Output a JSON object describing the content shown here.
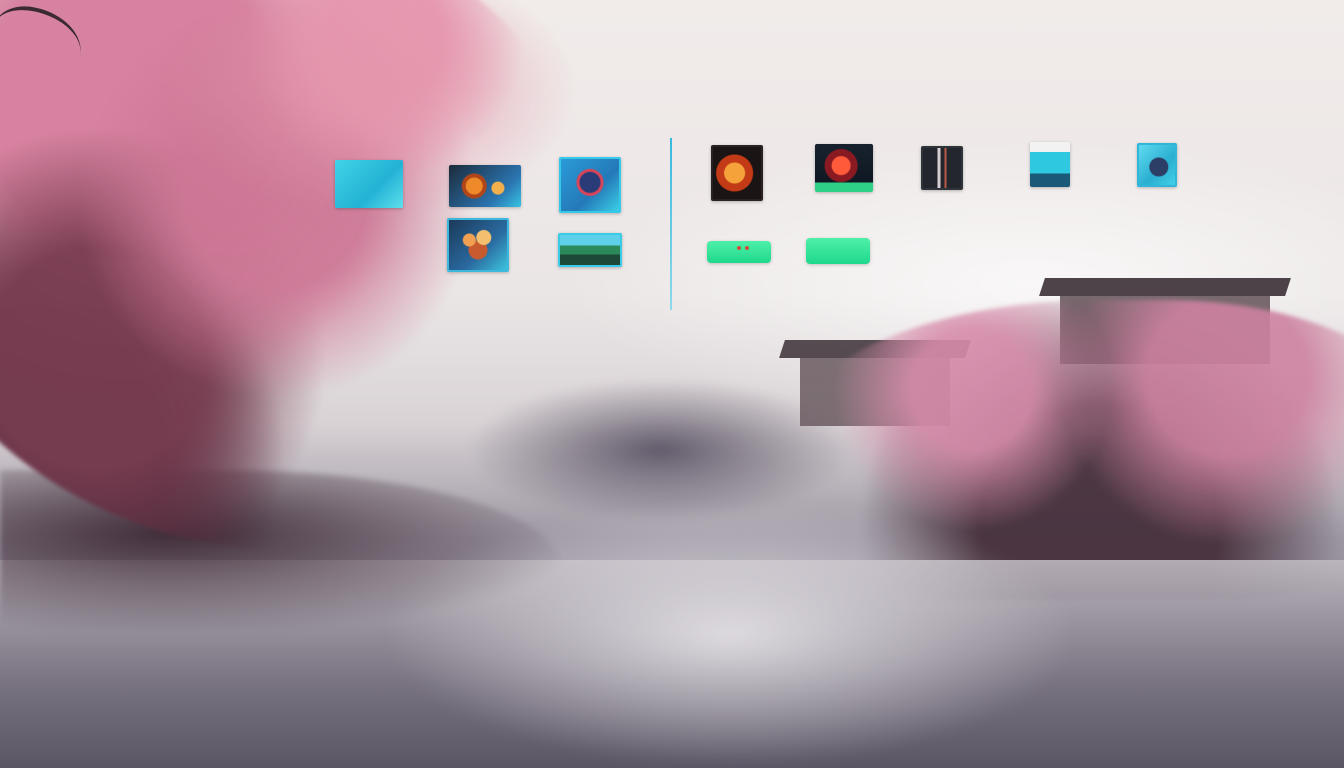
{
  "desktop": {
    "icons": [
      {
        "id": "icon-cyan-window",
        "icon": "app-window-icon",
        "color": "#3fd4e8"
      },
      {
        "id": "icon-food-photo",
        "icon": "food-photo-icon",
        "color": "#2b74b0"
      },
      {
        "id": "icon-globe-photo",
        "icon": "globe-photo-icon",
        "color": "#2a9bd8"
      },
      {
        "id": "icon-flowers-photo",
        "icon": "flowers-photo-icon",
        "color": "#2a6aa0"
      },
      {
        "id": "icon-landscape-photo",
        "icon": "landscape-photo-icon",
        "color": "#3ccbe6"
      },
      {
        "id": "icon-fire-photo",
        "icon": "fire-photo-icon",
        "color": "#1a1414"
      },
      {
        "id": "icon-red-photo",
        "icon": "red-photo-icon",
        "color": "#18222e"
      },
      {
        "id": "icon-device-photo",
        "icon": "device-photo-icon",
        "color": "#23262c"
      },
      {
        "id": "icon-shop-photo",
        "icon": "shop-photo-icon",
        "color": "#2ec8e0"
      },
      {
        "id": "icon-figure-photo",
        "icon": "figure-photo-icon",
        "color": "#2aaed0"
      }
    ],
    "buttons": [
      {
        "id": "green-pill-1",
        "color": "#1fd88c"
      },
      {
        "id": "green-pill-2",
        "color": "#1fd88c"
      }
    ],
    "accent": "#38b8e0"
  }
}
